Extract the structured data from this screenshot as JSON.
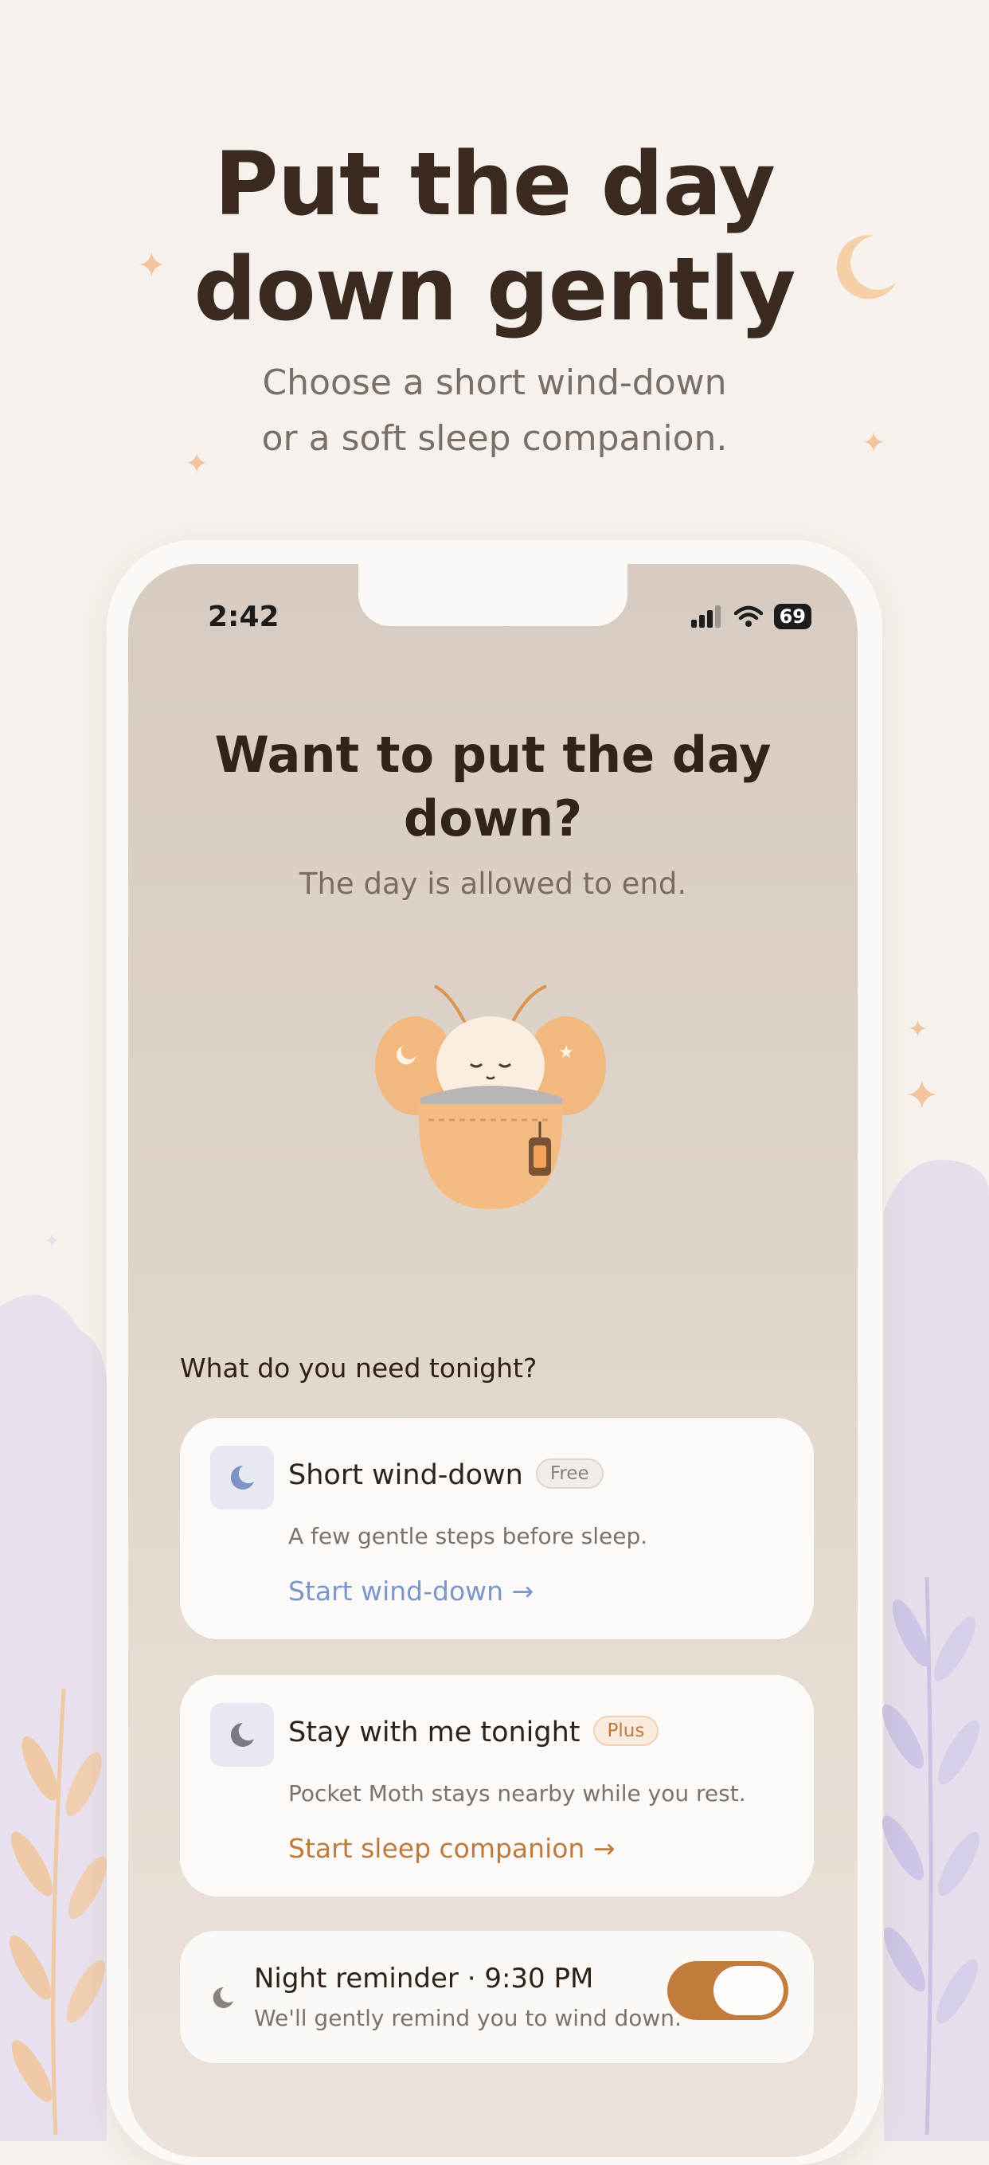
{
  "page": {
    "headline_line1": "Put the day",
    "headline_line2": "down gently",
    "subhead_line1": "Choose a short wind-down",
    "subhead_line2": "or a soft sleep companion."
  },
  "status_bar": {
    "time": "2:42",
    "battery": "69"
  },
  "screen": {
    "title_line1": "Want to put the day",
    "title_line2": "down?",
    "subtitle": "The day is allowed to end.",
    "question": "What do you need tonight?"
  },
  "options": [
    {
      "title": "Short wind-down",
      "badge": "Free",
      "description": "A few gentle steps before sleep.",
      "link": "Start wind-down →",
      "icon": "moon-icon"
    },
    {
      "title": "Stay with me tonight",
      "badge": "Plus",
      "description": "Pocket Moth stays nearby while you rest.",
      "link": "Start sleep companion →",
      "icon": "moon-icon"
    }
  ],
  "reminder": {
    "title": "Night reminder · 9:30 PM",
    "description": "We'll gently remind you to wind down.",
    "enabled": true
  },
  "colors": {
    "background": "#f6f1ec",
    "headline": "#3a2a1f",
    "free_link": "#7b97c9",
    "plus_link": "#c07a3c",
    "toggle_on": "#c27c3c"
  }
}
